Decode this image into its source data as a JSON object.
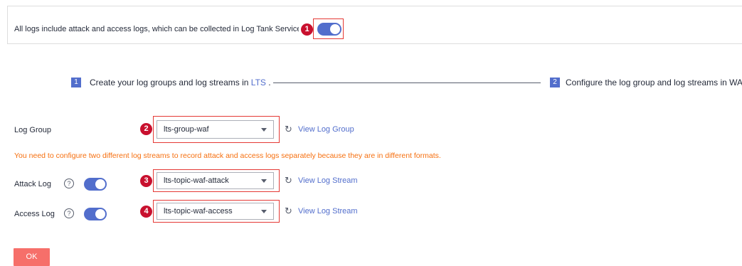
{
  "notice": {
    "text": "All logs include attack and access logs, which can be collected in Log Tank Service (LTS)",
    "toggle_on": true
  },
  "markers": [
    "1",
    "2",
    "3",
    "4"
  ],
  "steps": [
    {
      "number": "1",
      "text_before": "Create your log groups and log streams in ",
      "link": "LTS",
      "text_after": " ."
    },
    {
      "number": "2",
      "text": "Configure the log group and log streams in WA"
    }
  ],
  "log_group": {
    "label": "Log Group",
    "value": "lts-group-waf",
    "link": "View Log Group"
  },
  "warning": "You need to configure two different log streams to record attack and access logs separately because they are in different formats.",
  "attack_log": {
    "label": "Attack Log",
    "enabled": true,
    "value": "lts-topic-waf-attack",
    "link": "View Log Stream"
  },
  "access_log": {
    "label": "Access Log",
    "enabled": true,
    "value": "lts-topic-waf-access",
    "link": "View Log Stream"
  },
  "icons": {
    "help": "question-circle-icon",
    "refresh": "refresh-icon",
    "caret": "chevron-down-icon"
  },
  "colors": {
    "accent": "#526ecc",
    "warning": "#f66f0f",
    "ok_button": "#f66f6a",
    "marker": "#c8102e",
    "annotation": "#e53935"
  },
  "ok_button": "OK"
}
